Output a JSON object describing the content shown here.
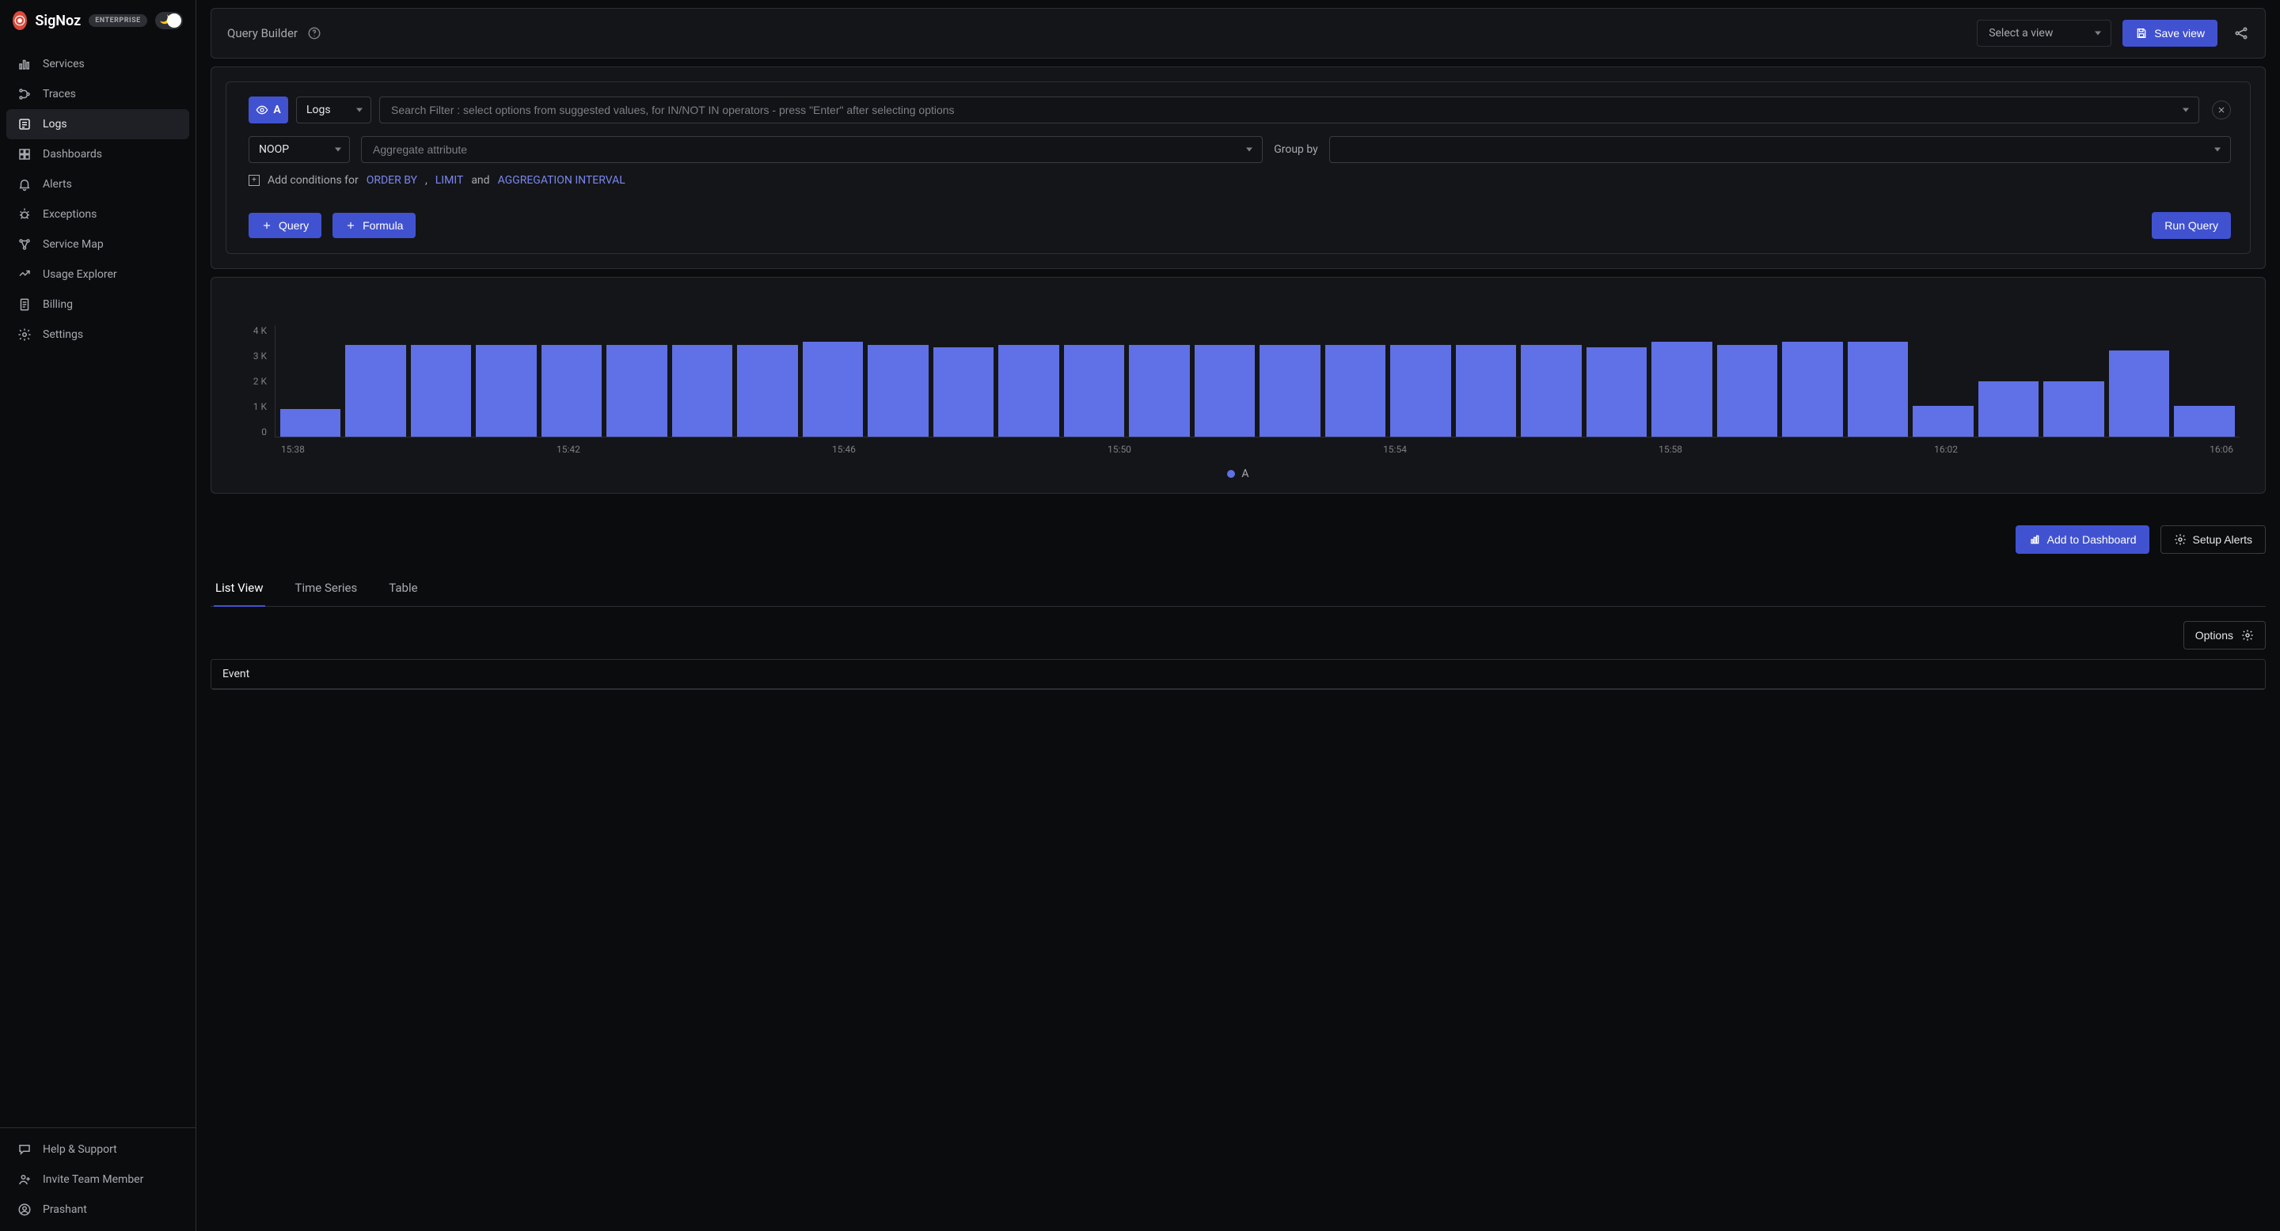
{
  "brand": {
    "name": "SigNoz",
    "tier": "ENTERPRISE"
  },
  "sidebar": {
    "items": [
      {
        "label": "Services",
        "icon": "bar-chart-icon"
      },
      {
        "label": "Traces",
        "icon": "branch-icon"
      },
      {
        "label": "Logs",
        "icon": "logs-icon"
      },
      {
        "label": "Dashboards",
        "icon": "grid-icon"
      },
      {
        "label": "Alerts",
        "icon": "bell-icon"
      },
      {
        "label": "Exceptions",
        "icon": "bug-icon"
      },
      {
        "label": "Service Map",
        "icon": "map-icon"
      },
      {
        "label": "Usage Explorer",
        "icon": "usage-icon"
      },
      {
        "label": "Billing",
        "icon": "receipt-icon"
      },
      {
        "label": "Settings",
        "icon": "gear-icon"
      }
    ],
    "active_index": 2,
    "bottom": [
      {
        "label": "Help & Support",
        "icon": "chat-icon"
      },
      {
        "label": "Invite Team Member",
        "icon": "user-plus-icon"
      },
      {
        "label": "Prashant",
        "icon": "avatar-icon"
      }
    ]
  },
  "query_builder": {
    "title": "Query Builder",
    "select_view_placeholder": "Select a view",
    "save_view": "Save view",
    "query_letter": "A",
    "source_type": "Logs",
    "filter_placeholder": "Search Filter : select options from suggested values, for IN/NOT IN operators - press \"Enter\" after selecting options",
    "noop": "NOOP",
    "agg_placeholder": "Aggregate attribute",
    "group_by_label": "Group by",
    "conditions": {
      "prefix": "Add conditions for",
      "order_by": "ORDER BY",
      "sep1": ",",
      "limit": "LIMIT",
      "and": "and",
      "agg_interval": "AGGREGATION INTERVAL"
    },
    "add_query": "Query",
    "add_formula": "Formula",
    "run_query": "Run Query"
  },
  "chart_data": {
    "type": "bar",
    "y_ticks": [
      "4 K",
      "3 K",
      "2 K",
      "1 K",
      "0"
    ],
    "y_max": 4000,
    "categories": [
      "15:38",
      "15:39",
      "15:40",
      "15:41",
      "15:42",
      "15:43",
      "15:44",
      "15:45",
      "15:46",
      "15:47",
      "15:48",
      "15:49",
      "15:50",
      "15:51",
      "15:52",
      "15:53",
      "15:54",
      "15:55",
      "15:56",
      "15:57",
      "15:58",
      "15:59",
      "16:00",
      "16:01",
      "16:02",
      "16:03",
      "16:04",
      "16:05",
      "16:06",
      "16:07"
    ],
    "x_tick_labels": [
      "15:38",
      "15:42",
      "15:46",
      "15:50",
      "15:54",
      "15:58",
      "16:02",
      "16:06"
    ],
    "series": [
      {
        "name": "A",
        "values": [
          1000,
          3300,
          3300,
          3300,
          3300,
          3300,
          3300,
          3300,
          3400,
          3300,
          3200,
          3300,
          3300,
          3300,
          3300,
          3300,
          3300,
          3300,
          3300,
          3300,
          3200,
          3400,
          3300,
          3400,
          3400,
          1100,
          2000,
          2000,
          3100,
          1100
        ]
      }
    ],
    "legend": {
      "name": "A"
    }
  },
  "under_chart": {
    "add_to_dashboard": "Add to Dashboard",
    "setup_alerts": "Setup Alerts"
  },
  "tabs": {
    "items": [
      "List View",
      "Time Series",
      "Table"
    ],
    "active_index": 0
  },
  "options_label": "Options",
  "event_table": {
    "header": "Event"
  }
}
